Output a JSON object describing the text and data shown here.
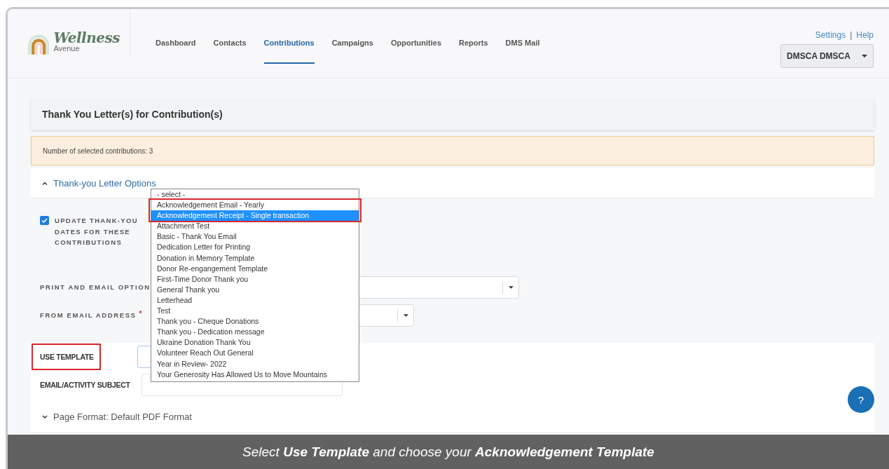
{
  "header": {
    "logo": {
      "name": "Wellness",
      "tagline": "Avenue"
    },
    "nav": [
      {
        "label": "Dashboard",
        "selected": false
      },
      {
        "label": "Contacts",
        "selected": false
      },
      {
        "label": "Contributions",
        "selected": true
      },
      {
        "label": "Campaigns",
        "selected": false
      },
      {
        "label": "Opportunities",
        "selected": false
      },
      {
        "label": "Reports",
        "selected": false
      },
      {
        "label": "DMS Mail",
        "selected": false
      }
    ],
    "top_links": [
      "Settings",
      "Help"
    ],
    "separator": "|",
    "user_menu": "DMSCA DMSCA"
  },
  "page_title": "Thank You Letter(s) for Contribution(s)",
  "alert": "Number of selected contributions: 3",
  "letter_options": {
    "title": "Thank-you Letter Options",
    "expanded": true,
    "update_dates": {
      "label": "UPDATE THANK-YOU DATES FOR THESE CONTRIBUTIONS",
      "checked": true
    },
    "fields": [
      {
        "label": "PRINT AND EMAIL OPTION",
        "kind": "select"
      },
      {
        "label": "FROM EMAIL ADDRESS",
        "required_mark": "*",
        "kind": "select"
      }
    ],
    "template_fields": [
      {
        "label": "USE TEMPLATE",
        "kind": "select",
        "callout": true
      },
      {
        "label": "EMAIL/ACTIVITY SUBJECT",
        "kind": "text",
        "callout": false
      }
    ],
    "template_dropdown": [
      {
        "label": "- select -",
        "selected": false,
        "callout": false
      },
      {
        "label": "Acknowledgement Email - Yearly",
        "selected": false,
        "callout": true
      },
      {
        "label": "Acknowledgement Receipt - Single transaction",
        "selected": true,
        "callout": true
      },
      {
        "label": "Attachment Test",
        "selected": false,
        "callout": false
      },
      {
        "label": "Basic - Thank You Email",
        "selected": false,
        "callout": false
      },
      {
        "label": "Dedication Letter for Printing",
        "selected": false,
        "callout": false
      },
      {
        "label": "Donation in Memory Template",
        "selected": false,
        "callout": false
      },
      {
        "label": "Donor Re-engangement Template",
        "selected": false,
        "callout": false
      },
      {
        "label": "First-Time Donor Thank you",
        "selected": false,
        "callout": false
      },
      {
        "label": "General Thank you",
        "selected": false,
        "callout": false
      },
      {
        "label": "Letterhead",
        "selected": false,
        "callout": false
      },
      {
        "label": "Test",
        "selected": false,
        "callout": false
      },
      {
        "label": "Thank you - Cheque Donations",
        "selected": false,
        "callout": false
      },
      {
        "label": "Thank you - Dedication message",
        "selected": false,
        "callout": false
      },
      {
        "label": "Ukraine Donation Thank You",
        "selected": false,
        "callout": false
      },
      {
        "label": "Volunteer Reach Out General",
        "selected": false,
        "callout": false
      },
      {
        "label": "Year in Review- 2022",
        "selected": false,
        "callout": false
      },
      {
        "label": "Your Generosity Has Allowed Us to Move Mountains",
        "selected": false,
        "callout": false
      }
    ]
  },
  "page_format": {
    "title": "Page Format: Default PDF Format",
    "expanded": false
  },
  "help_button": "?",
  "caption": "Select **Use Template** and choose your **Acknowledgement Template**"
}
